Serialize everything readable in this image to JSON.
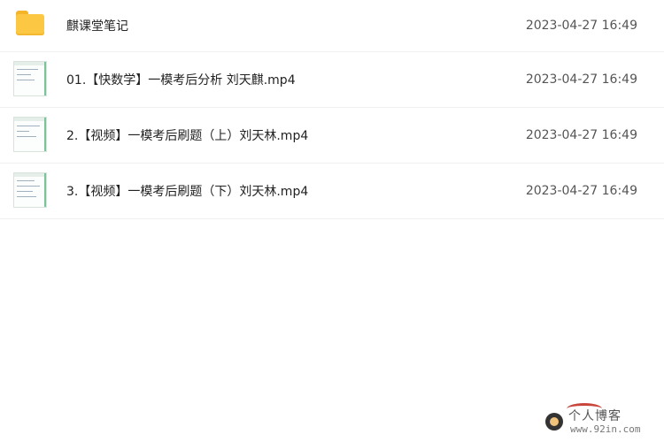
{
  "files": [
    {
      "name": "麒课堂笔记",
      "time": "2023-04-27 16:49",
      "icon": "folder-icon"
    },
    {
      "name": "01.【快数学】一模考后分析 刘天麒.mp4",
      "time": "2023-04-27 16:49",
      "icon": "video-thumbnail-icon"
    },
    {
      "name": "2.【视频】一模考后刷题（上）刘天林.mp4",
      "time": "2023-04-27 16:49",
      "icon": "video-thumbnail-icon"
    },
    {
      "name": "3.【视频】一模考后刷题（下）刘天林.mp4",
      "time": "2023-04-27 16:49",
      "icon": "video-thumbnail-icon"
    }
  ],
  "watermark": {
    "title": "个人博客",
    "url": "www.92in.com"
  },
  "colors": {
    "folder": "#fcc844",
    "text": "#222222",
    "time": "#555555",
    "divider": "#f0f0f0"
  }
}
